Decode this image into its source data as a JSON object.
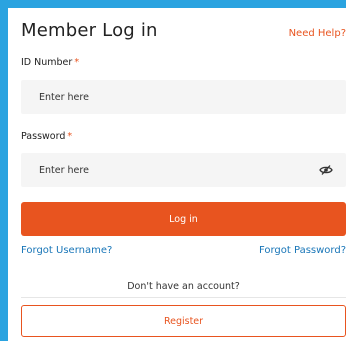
{
  "header": {
    "title": "Member Log in",
    "help_link": "Need Help?"
  },
  "form": {
    "id_label": "ID Number",
    "id_placeholder": "Enter here",
    "password_label": "Password",
    "password_placeholder": "Enter here",
    "required_mark": "*",
    "eye_icon": "eye-slash-icon",
    "login_label": "Log in",
    "forgot_username": "Forgot Username?",
    "forgot_password": "Forgot Password?"
  },
  "signup": {
    "prompt": "Don't have an account?",
    "register_label": "Register"
  },
  "colors": {
    "accent": "#e8541f",
    "link": "#1976b8",
    "frame": "#2aa3e0",
    "input_bg": "#f5f5f5"
  }
}
